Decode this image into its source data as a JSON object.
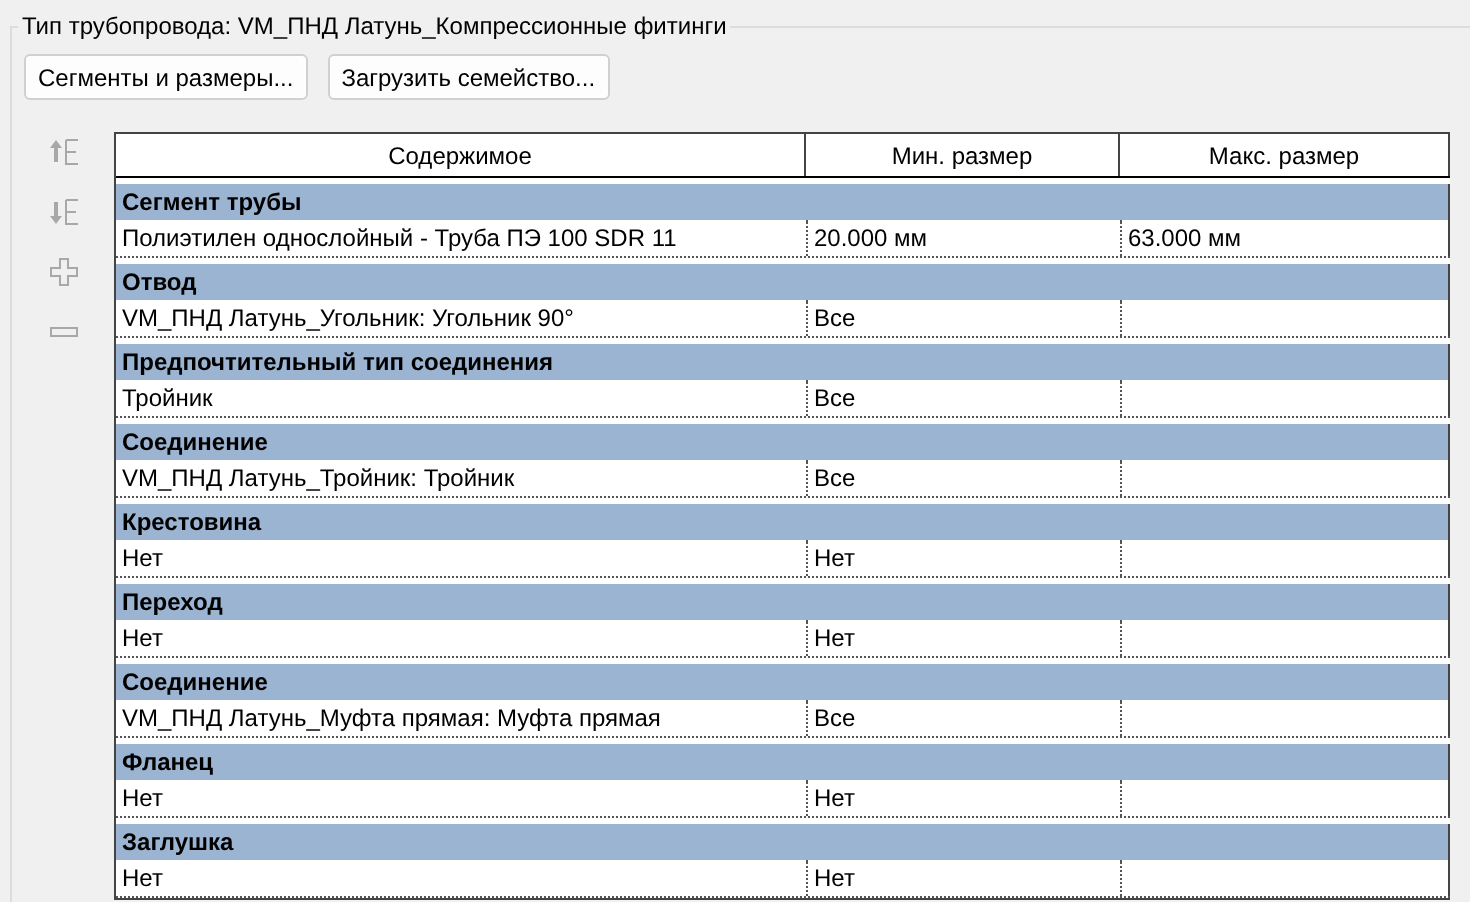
{
  "group_title": "Тип трубопровода: VM_ПНД Латунь_Компрессионные фитинги",
  "buttons": [
    "Сегменты и размеры...",
    "Загрузить семейство..."
  ],
  "side_tools": [
    {
      "kind": "move-up",
      "disabled": true
    },
    {
      "kind": "move-down",
      "disabled": true
    },
    {
      "kind": "add",
      "disabled": true
    },
    {
      "kind": "remove",
      "disabled": true
    }
  ],
  "table": {
    "columns": [
      "Содержимое",
      "Мин. размер",
      "Макс. размер"
    ],
    "groups": [
      {
        "title": "Сегмент трубы",
        "row": [
          "Полиэтилен однослойный - Труба ПЭ 100 SDR 11",
          "20.000 мм",
          "63.000 мм"
        ]
      },
      {
        "title": "Отвод",
        "row": [
          "VM_ПНД Латунь_Угольник: Угольник 90°",
          "Все"
        ]
      },
      {
        "title": "Предпочтительный тип соединения",
        "row": [
          "Тройник",
          "Все"
        ]
      },
      {
        "title": "Соединение",
        "row": [
          "VM_ПНД Латунь_Тройник: Тройник",
          "Все"
        ]
      },
      {
        "title": "Крестовина",
        "row": [
          "Нет",
          "Нет"
        ]
      },
      {
        "title": "Переход",
        "row": [
          "Нет",
          "Нет"
        ]
      },
      {
        "title": "Соединение",
        "row": [
          "VM_ПНД Латунь_Муфта прямая: Муфта прямая",
          "Все"
        ]
      },
      {
        "title": "Фланец",
        "row": [
          "Нет",
          "Нет"
        ]
      },
      {
        "title": "Заглушка",
        "row": [
          "Нет",
          "Нет"
        ]
      }
    ]
  }
}
